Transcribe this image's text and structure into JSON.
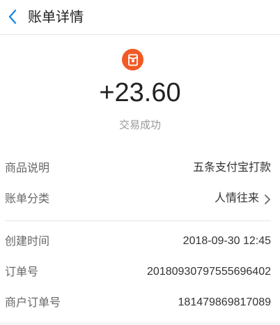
{
  "header": {
    "title": "账单详情"
  },
  "summary": {
    "amount": "+23.60",
    "status": "交易成功",
    "icon": "red-envelope-icon",
    "icon_color": "#f15a24"
  },
  "details_group1": [
    {
      "label": "商品说明",
      "value": "五条支付宝打款"
    },
    {
      "label": "账单分类",
      "value": "人情往来"
    }
  ],
  "details_group2": [
    {
      "label": "创建时间",
      "value": "2018-09-30 12:45"
    },
    {
      "label": "订单号",
      "value": "20180930797555696402"
    },
    {
      "label": "商户订单号",
      "value": "181479869817089"
    }
  ],
  "colors": {
    "accent": "#1a8ae5",
    "icon_bg": "#f15a24"
  }
}
